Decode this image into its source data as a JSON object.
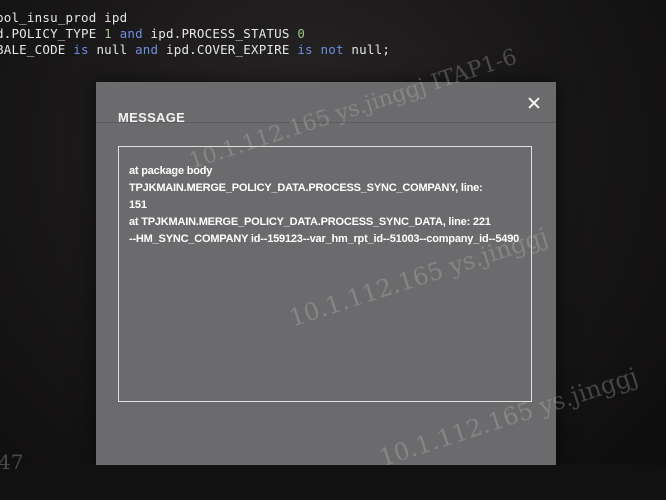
{
  "editor": {
    "line1": {
      "a": "pol_insu_prod ipd"
    },
    "line2": {
      "a": "d.POLICY_TYPE ",
      "b": "1",
      "c": " and ",
      "d": "ipd.PROCESS_STATUS ",
      "e": "0"
    },
    "line3": {
      "a": "BALE_CODE ",
      "b": "is",
      "c": " null ",
      "d": "and",
      "e": " ipd.COVER_EXPIRE ",
      "f": "is",
      "g": " ",
      "h": "not",
      "i": " null;"
    }
  },
  "dialog": {
    "title": "MESSAGE",
    "message": "at package body TPJKMAIN.MERGE_POLICY_DATA.PROCESS_SYNC_COMPANY, line:\n151\nat TPJKMAIN.MERGE_POLICY_DATA.PROCESS_SYNC_DATA, line: 221\n--HM_SYNC_COMPANY id--159123--var_hm_rpt_id--51003--company_id--5490"
  },
  "watermarks": {
    "wm1": "10.1.112.165 ys.jinggj ITAP1-6",
    "wm2": "10.1.112.165 ys.jinggj",
    "wm3": "10.1.112.165 ys.jinggj",
    "edge": "47"
  }
}
